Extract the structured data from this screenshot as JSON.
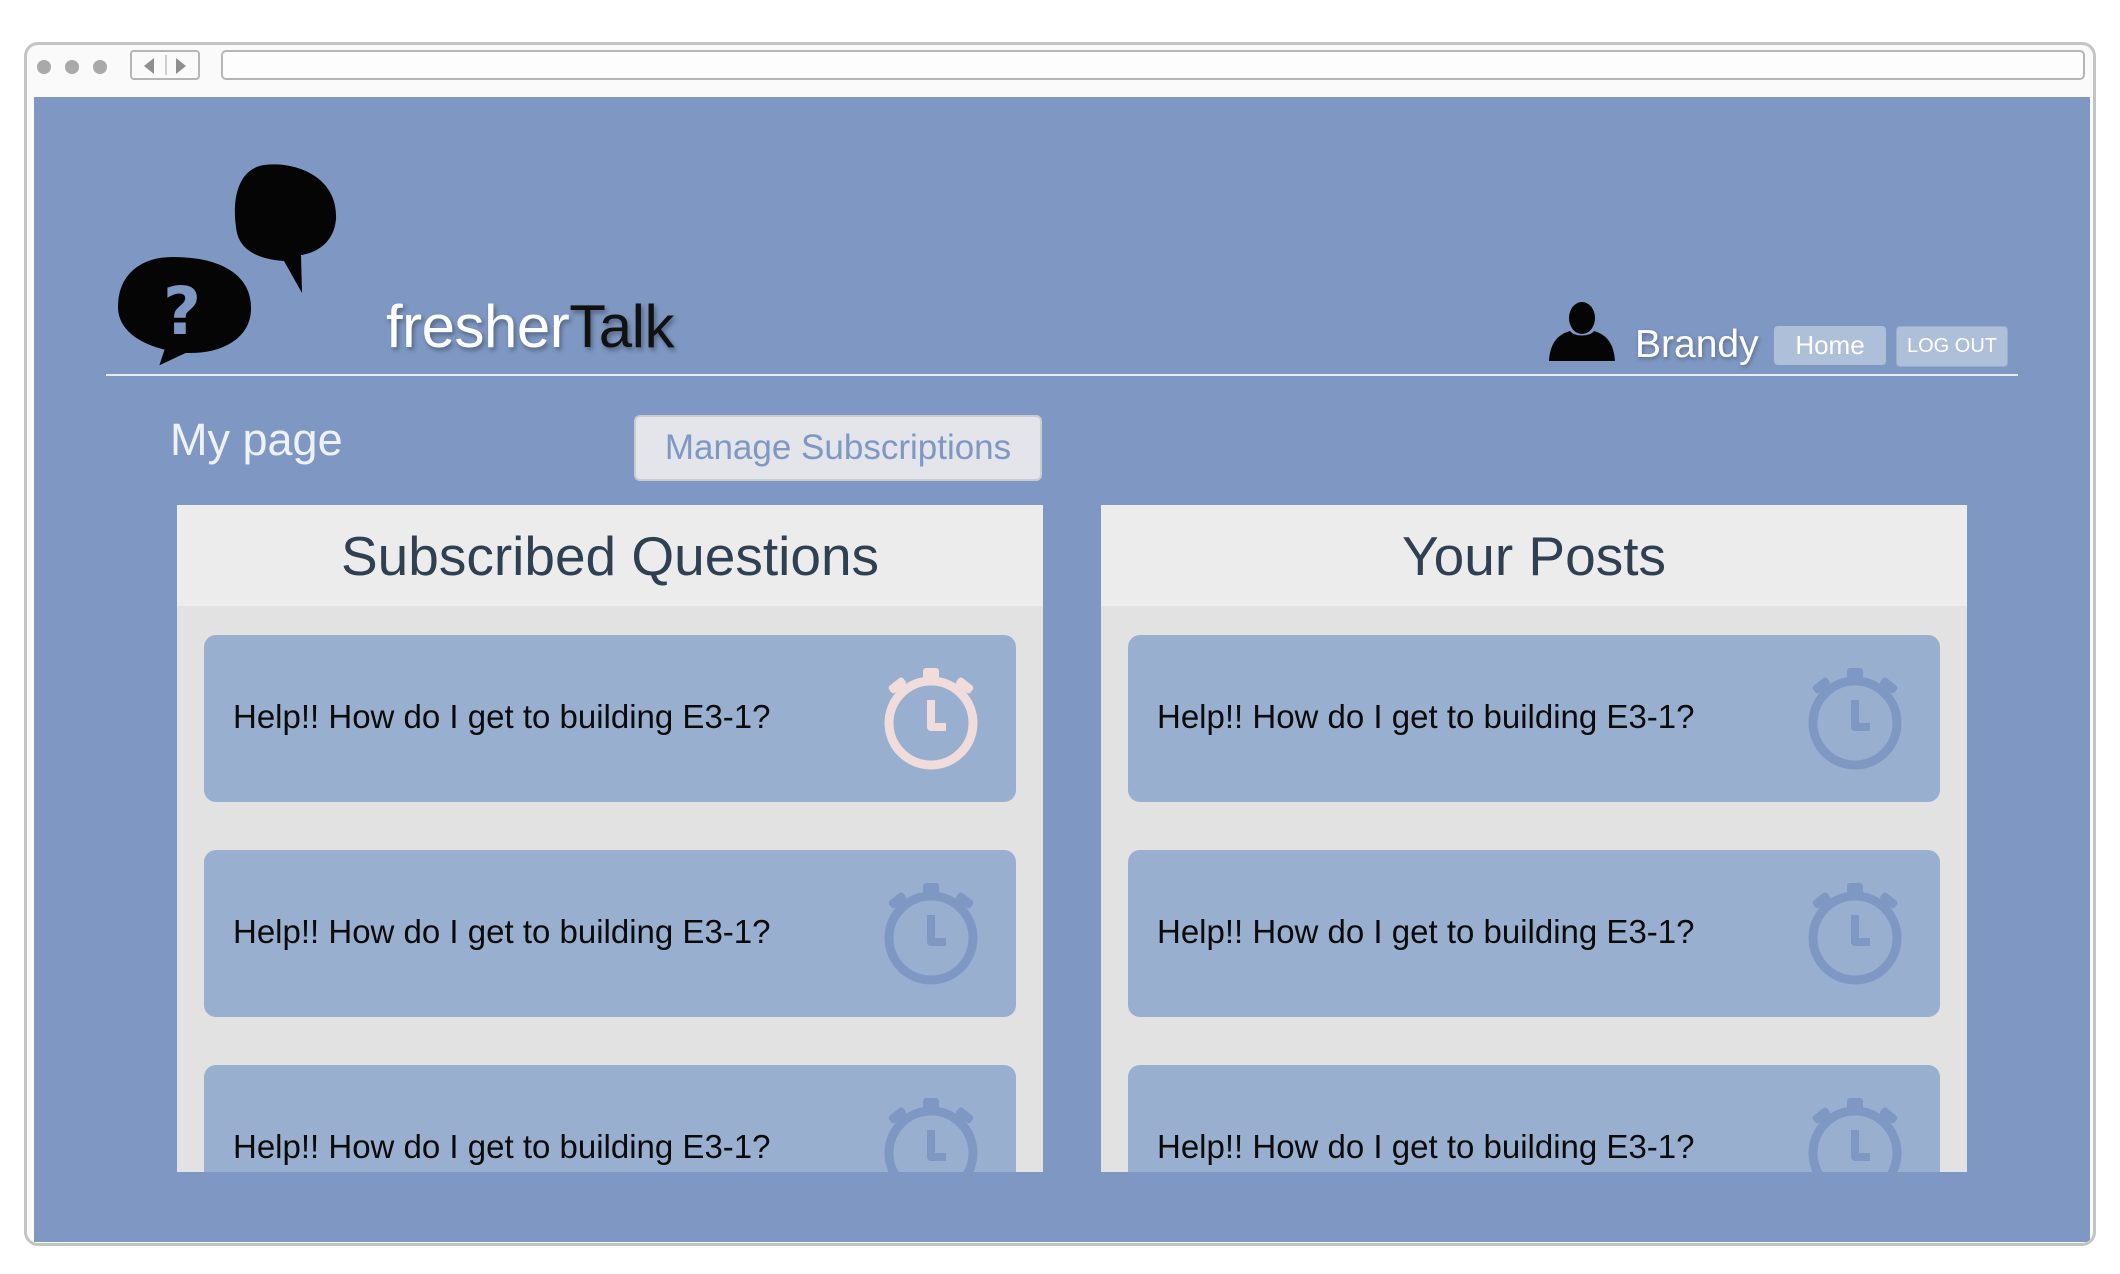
{
  "brand": {
    "part1": "fresher",
    "part2": "Talk"
  },
  "header": {
    "username": "Brandy",
    "home_label": "Home",
    "logout_label": "LOG OUT"
  },
  "page": {
    "title": "My page",
    "manage_label": "Manage Subscriptions"
  },
  "subscribed": {
    "title": "Subscribed Questions",
    "items": [
      {
        "text": "Help!! How do I get to building E3-1?",
        "clock_color": "#f0dcda"
      },
      {
        "text": "Help!! How do I get to building E3-1?",
        "clock_color": "#7e98c3"
      },
      {
        "text": "Help!! How do I get to building E3-1?",
        "clock_color": "#7e98c3"
      }
    ]
  },
  "posts": {
    "title": "Your Posts",
    "items": [
      {
        "text": "Help!! How do I get to building E3-1?",
        "clock_color": "#7e98c3"
      },
      {
        "text": "Help!! How do I get to building E3-1?",
        "clock_color": "#7e98c3"
      },
      {
        "text": "Help!! How do I get to building E3-1?",
        "clock_color": "#7e98c3"
      }
    ]
  },
  "colors": {
    "page_background": "#7e98c3",
    "card_background": "#99afcf",
    "panel_background": "#e2e2e2",
    "panel_title": "#2e4052"
  },
  "icons": [
    "speech-bubbles-logo-icon",
    "user-silhouette-icon",
    "stopwatch-icon"
  ]
}
